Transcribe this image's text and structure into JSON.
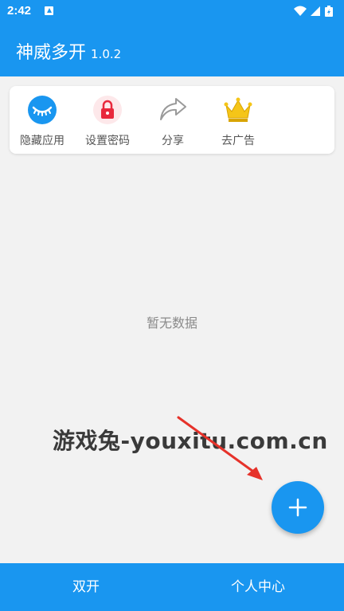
{
  "status_bar": {
    "time": "2:42"
  },
  "app": {
    "title": "神威多开",
    "version": "1.0.2"
  },
  "actions": [
    {
      "label": "隐藏应用",
      "icon": "eye-closed-icon"
    },
    {
      "label": "设置密码",
      "icon": "lock-icon"
    },
    {
      "label": "分享",
      "icon": "share-arrow-icon"
    },
    {
      "label": "去广告",
      "icon": "crown-icon"
    }
  ],
  "empty_text": "暂无数据",
  "watermark": "游戏兔-youxitu.com.cn",
  "bottom_nav": {
    "left": "双开",
    "right": "个人中心"
  },
  "colors": {
    "primary": "#1996f0",
    "lock_red": "#e8283c",
    "crown_gold": "#f5c518"
  }
}
